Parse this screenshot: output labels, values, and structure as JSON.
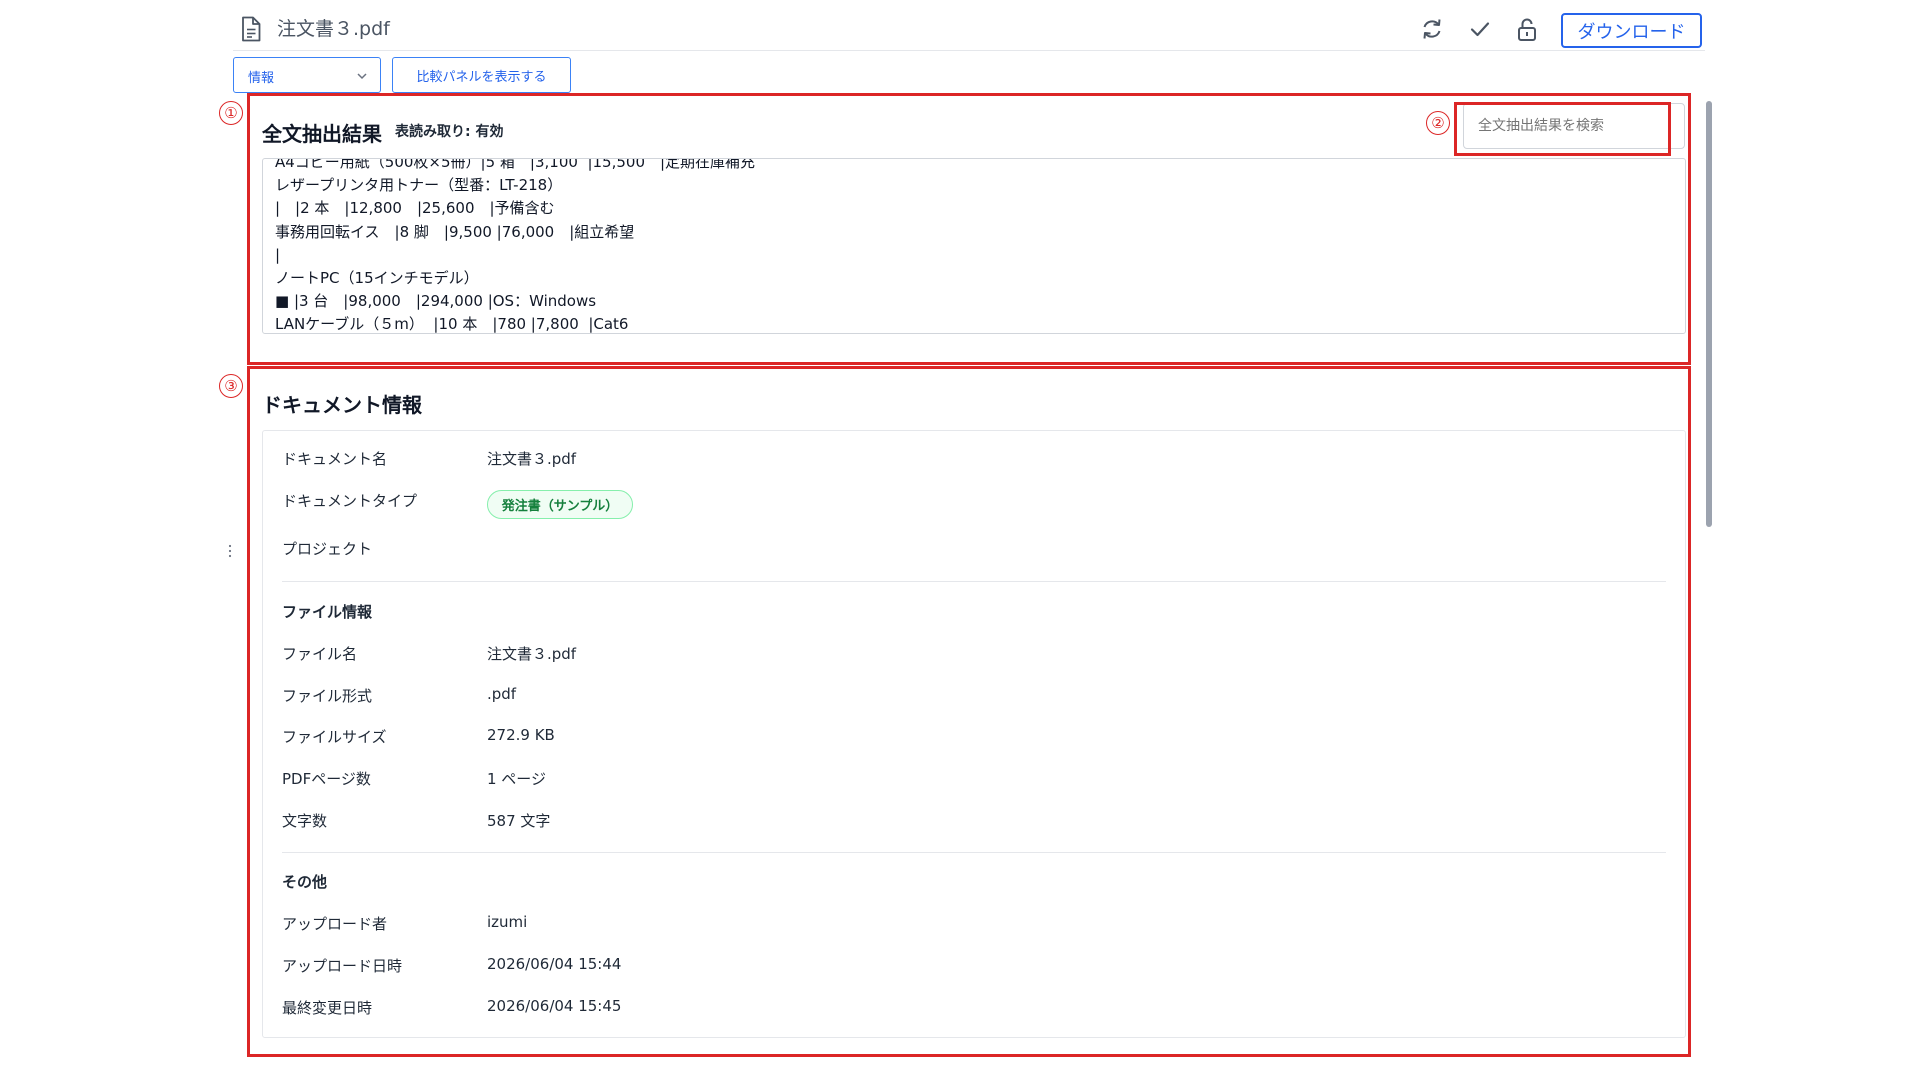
{
  "header": {
    "title": "注文書３.pdf",
    "download_label": "ダウンロード"
  },
  "toolbar": {
    "view_select": "情報",
    "compare_label": "比較パネルを表示する"
  },
  "callouts": [
    "①",
    "②",
    "③"
  ],
  "extraction": {
    "title": "全文抽出結果",
    "table_reading": "表読み取り: 有効",
    "search_placeholder": "全文抽出結果を検索",
    "lines": [
      "A4コピー用紙（500枚×5冊）|5 箱　|3,100  |15,500　|定期在庫補充",
      "レザープリンタ用トナー（型番：LT-218）",
      "|　|2 本　|12,800　|25,600　|予備含む",
      "事務用回転イス　|8 脚　|9,500 |76,000　|組立希望",
      "|",
      "ノートPC（15インチモデル）",
      "■ |3 台　|98,000　|294,000 |OS：Windows",
      "LANケーブル（５m）  |10 本　|780 |7,800  |Cat6"
    ]
  },
  "doc_info": {
    "title": "ドキュメント情報",
    "rows": [
      {
        "label": "ドキュメント名",
        "value": "注文書３.pdf"
      },
      {
        "label": "ドキュメントタイプ",
        "value": "発注書（サンプル）"
      },
      {
        "label": "プロジェクト",
        "value": ""
      }
    ],
    "file_group": "ファイル情報",
    "file_rows": [
      {
        "label": "ファイル名",
        "value": "注文書３.pdf"
      },
      {
        "label": "ファイル形式",
        "value": ".pdf"
      },
      {
        "label": "ファイルサイズ",
        "value": "272.9 KB"
      },
      {
        "label": "PDFページ数",
        "value": "1 ページ"
      },
      {
        "label": "文字数",
        "value": "587 文字"
      }
    ],
    "other_group": "その他",
    "other_rows": [
      {
        "label": "アップロード者",
        "value": "izumi"
      },
      {
        "label": "アップロード日時",
        "value": "2026/06/04 15:44"
      },
      {
        "label": "最終変更日時",
        "value": "2026/06/04 15:45"
      }
    ]
  },
  "colors": {
    "accent": "#2563eb",
    "callout_red": "#dc2626",
    "badge_green": "#15803d"
  }
}
